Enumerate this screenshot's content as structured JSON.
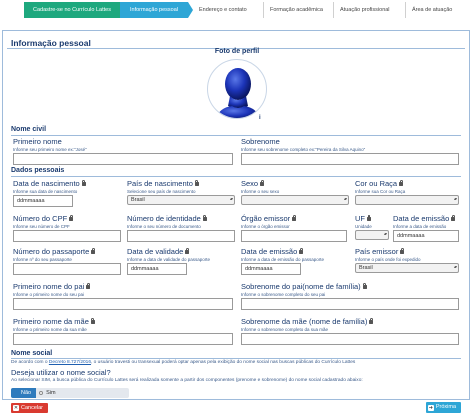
{
  "steps": [
    {
      "label": "Cadastre-se no Currículo Lattes",
      "state": "done"
    },
    {
      "label": "Informação pessoal",
      "state": "active"
    },
    {
      "label": "Endereço e contato",
      "state": "next"
    },
    {
      "label": "Formação acadêmica",
      "state": "next"
    },
    {
      "label": "Atuação profissional",
      "state": "next"
    },
    {
      "label": "Área de atuação",
      "state": "next"
    }
  ],
  "panel": {
    "title": "Informação pessoal",
    "photo_label": "Foto de perfil",
    "photo_info_mark": "i"
  },
  "nome_civil": {
    "section": "Nome civil",
    "primeiro_nome": {
      "label": "Primeiro nome",
      "help": "Informe seu primeiro nome ex:\"José\"",
      "value": ""
    },
    "sobrenome": {
      "label": "Sobrenome",
      "help": "Informe seu sobrenome completo ex:\"Pereira da Silva Aquino\"",
      "value": ""
    }
  },
  "dados_pessoais": {
    "section": "Dados pessoais",
    "data_nascimento": {
      "label": "Data de nascimento",
      "help": "Informe sua data de nascimento",
      "value": "ddmmaaaa"
    },
    "pais_nascimento": {
      "label": "País de nascimento",
      "help": "Selecione seu país de nascimento",
      "value": "Brasil"
    },
    "sexo": {
      "label": "Sexo",
      "help": "Informe o seu sexo",
      "value": ""
    },
    "cor_raca": {
      "label": "Cor ou Raça",
      "help": "Informe sua Cor ou Raça",
      "value": ""
    },
    "cpf": {
      "label": "Número do CPF",
      "help": "Informe seu número de CPF",
      "value": ""
    },
    "identidade": {
      "label": "Número de identidade",
      "help": "Informe o seu número de documento",
      "value": ""
    },
    "orgao_emissor": {
      "label": "Órgão emissor",
      "help": "Informe o órgão emissor",
      "value": ""
    },
    "uf": {
      "label": "UF",
      "help": "Unidade",
      "value": ""
    },
    "data_emissao": {
      "label": "Data de emissão",
      "help": "Informe a data de emissão",
      "value": "ddmmaaaa"
    },
    "passaporte": {
      "label": "Número do passaporte",
      "help": "Informe nº do seu passaporte",
      "value": ""
    },
    "data_validade": {
      "label": "Data de validade",
      "help": "Informe a data de validade do passaporte",
      "value": "ddmmaaaa"
    },
    "data_emissao_passaporte": {
      "label": "Data de emissão",
      "help": "Informe a data de emissão do passaporte",
      "value": "ddmmaaaa"
    },
    "pais_emissor": {
      "label": "País emissor",
      "help": "Informe o país onde foi expedido",
      "value": "Brasil"
    },
    "primeiro_nome_pai": {
      "label": "Primeiro nome do pai",
      "help": "Informe o primeiro nome do seu pai",
      "value": ""
    },
    "sobrenome_pai": {
      "label": "Sobrenome do pai(nome de família)",
      "help": "Informe o sobrenome completo do seu pai",
      "value": ""
    },
    "primeiro_nome_mae": {
      "label": "Primeiro nome da mãe",
      "help": "Informe o primeiro nome da sua mãe",
      "value": ""
    },
    "sobrenome_mae": {
      "label": "Sobrenome da mãe (nome de família)",
      "help": "Informe o sobrenome completo da sua mãe",
      "value": ""
    }
  },
  "nome_social": {
    "section": "Nome social",
    "note_prefix": "De acordo com o",
    "note_link": "Decreto 8.727/2016",
    "note_suffix": ", o usuário travesti ou transexual poderá optar apenas pela exibição do nome social nas buscas públicas do Currículo Lattes",
    "question": "Deseja utilizar o nome social?",
    "help": "Ao selecionar SIM, a busca pública do Currículo Lattes será realizada somente a partir dos componentes (prenome e sobrenome) do nome social cadastrado abaixo:",
    "option_no": "Não",
    "option_yes": "Sim",
    "selected": "Não"
  },
  "actions": {
    "cancel": "Cancelar",
    "cancel_icon": "x-icon",
    "next": "Próxima",
    "next_icon": "arrow-right-icon"
  },
  "colors": {
    "step_done": "#1ea87e",
    "step_active": "#2ea6d6",
    "cancel": "#d93a30",
    "next": "#2ea6d6",
    "toggle_on": "#2f7bbd"
  }
}
